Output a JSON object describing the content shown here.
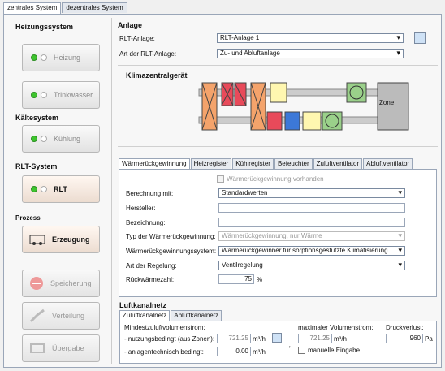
{
  "top_tabs": [
    "zentrales System",
    "dezentrales System"
  ],
  "left": {
    "heizung_title": "Heizungssystem",
    "heizung_btn": "Heizung",
    "trinkwasser_btn": "Trinkwasser",
    "kalte_title": "Kältesystem",
    "kuhlung_btn": "Kühlung",
    "rlt_title": "RLT-System",
    "rlt_btn": "RLT",
    "prozess_title": "Prozess",
    "erzeugung_btn": "Erzeugung",
    "speicherung_btn": "Speicherung",
    "verteilung_btn": "Verteilung",
    "ubergabe_btn": "Übergabe"
  },
  "anlage": {
    "title": "Anlage",
    "rlt_label": "RLT-Anlage:",
    "rlt_value": "RLT-Anlage 1",
    "art_label": "Art der RLT-Anlage:",
    "art_value": "Zu- und Abluftanlage"
  },
  "klima": {
    "title": "Klimazentralgerät",
    "zone": "Zone"
  },
  "tabs": [
    "Wärmerückgewinnung",
    "Heizregister",
    "Kühlregister",
    "Befeuchter",
    "Zuluftventilator",
    "Abluftventilator"
  ],
  "wrg": {
    "checkbox": "Wärmerückgewinnung vorhanden",
    "berechnung_label": "Berechnung mit:",
    "berechnung_value": "Standardwerten",
    "hersteller_label": "Hersteller:",
    "bezeichnung_label": "Bezeichnung:",
    "typ_label": "Typ der Wärmerückgewinnung:",
    "typ_value": "Wärmerückgewinnung, nur Wärme",
    "system_label": "Wärmerückgewinnungssystem:",
    "system_value": "Wärmerückgewinner für sorptionsgestützte Klimatisierung",
    "regelung_label": "Art der Regelung:",
    "regelung_value": "Ventilregelung",
    "ruck_label": "Rückwärmezahl:",
    "ruck_value": "75",
    "ruck_unit": "%"
  },
  "luft": {
    "title": "Luftkanalnetz",
    "tabs": [
      "Zuluftkanalnetz",
      "Abluftkanalnetz"
    ],
    "mindest_label": "Mindestzuluftvolumenstrom:",
    "nutzung_label": "- nutzungsbedingt (aus Zonen):",
    "nutzung_value": "721.25",
    "unit": "m³/h",
    "anlage_label": "- anlagentechnisch bedingt:",
    "anlage_value": "0.00",
    "max_label": "maximaler Volumenstrom:",
    "max_value": "721.25",
    "manuelle": "manuelle Eingabe",
    "druck_label": "Druckverlust:",
    "druck_value": "960",
    "druck_unit": "Pa"
  }
}
